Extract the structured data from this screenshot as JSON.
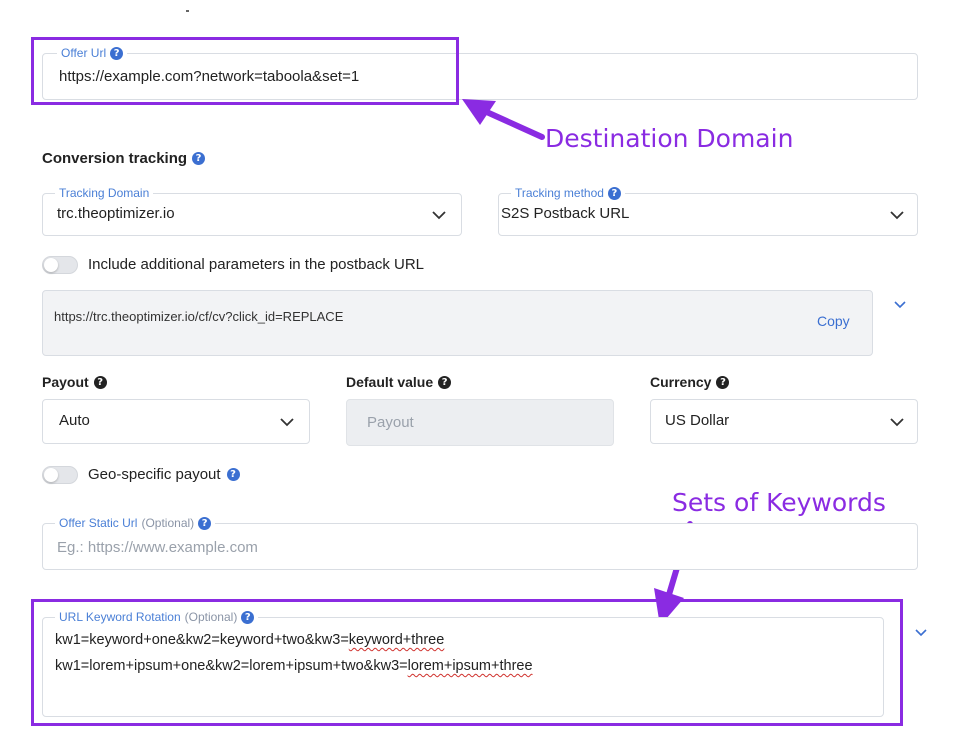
{
  "offer_url": {
    "label": "Offer Url",
    "value": "https://example.com?network=taboola&set=1"
  },
  "annotations": {
    "destination": "Destination Domain",
    "keywords": "Sets of Keywords",
    "color": "#8a2be2"
  },
  "conversion": {
    "title": "Conversion tracking",
    "tracking_domain": {
      "label": "Tracking Domain",
      "value": "trc.theoptimizer.io"
    },
    "tracking_method": {
      "label": "Tracking method",
      "value": "S2S Postback URL"
    },
    "include_params_label": "Include additional parameters in the postback URL",
    "postback_url": "https://trc.theoptimizer.io/cf/cv?click_id=REPLACE",
    "copy_label": "Copy"
  },
  "payout": {
    "label": "Payout",
    "value": "Auto"
  },
  "default_value": {
    "label": "Default value",
    "placeholder": "Payout"
  },
  "currency": {
    "label": "Currency",
    "value": "US Dollar"
  },
  "geo_payout_label": "Geo-specific payout",
  "static_url": {
    "label": "Offer Static Url",
    "optional": "(Optional)",
    "placeholder": "Eg.: https://www.example.com"
  },
  "keyword_rotation": {
    "label": "URL Keyword Rotation",
    "optional": "(Optional)",
    "line1_prefix": "kw1=keyword+one&kw2=keyword+two&kw3=",
    "line1_squiggle": "keyword+three",
    "line2_prefix": "kw1=lorem+ipsum+one&kw2=lorem+ipsum+two&kw3=",
    "line2_squiggle": "lorem+ipsum+three"
  },
  "icons": [
    "question-icon",
    "chevron-down-icon",
    "arrow-icon"
  ]
}
